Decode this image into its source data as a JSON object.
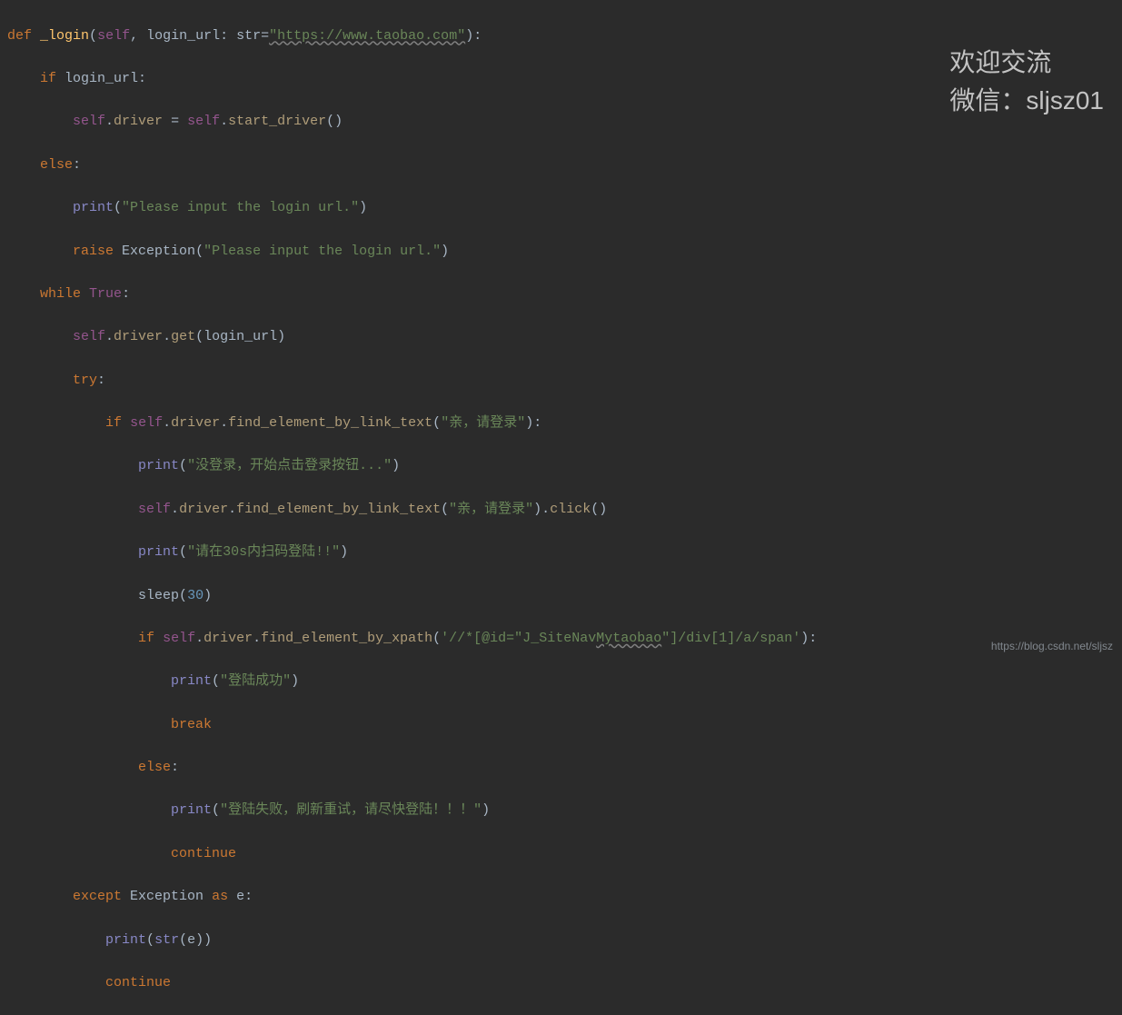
{
  "code": {
    "l1_def": "def",
    "l1_fn": "_login",
    "l1_open": "(",
    "l1_self": "self",
    "l1_comma": ",",
    "l1_param": " login_url",
    "l1_colon": ": ",
    "l1_type": "str",
    "l1_eq": "=",
    "l1_str": "\"https://www.taobao.com\"",
    "l1_close": "):",
    "l2_if": "if",
    "l2_cond": " login_url",
    "l2_colon": ":",
    "l3_self": "self",
    "l3_dot1": ".",
    "l3_driver_attr": "driver",
    "l3_eq": " = ",
    "l3_self2": "self",
    "l3_dot2": ".",
    "l3_start": "start_driver",
    "l3_call": "()",
    "l4_else": "else",
    "l4_colon": ":",
    "l5_print": "print",
    "l5_open": "(",
    "l5_str": "\"Please input the login url.\"",
    "l5_close": ")",
    "l6_raise": "raise",
    "l6_sp": " ",
    "l6_exc": "Exception",
    "l6_open": "(",
    "l6_str": "\"Please input the login url.\"",
    "l6_close": ")",
    "l7_while": "while",
    "l7_sp": " ",
    "l7_true": "True",
    "l7_colon": ":",
    "l8_self": "self",
    "l8_dot": ".",
    "l8_driver": "driver",
    "l8_dot2": ".",
    "l8_get": "get",
    "l8_open": "(",
    "l8_arg": "login_url",
    "l8_close": ")",
    "l9_try": "try",
    "l9_colon": ":",
    "l10_if": "if",
    "l10_sp": " ",
    "l10_self": "self",
    "l10_dot": ".",
    "l10_driver": "driver",
    "l10_dot2": ".",
    "l10_find": "find_element_by_link_text",
    "l10_open": "(",
    "l10_str": "\"亲，请登录\"",
    "l10_close": "):",
    "l11_print": "print",
    "l11_open": "(",
    "l11_str": "\"没登录，开始点击登录按钮...\"",
    "l11_close": ")",
    "l12_self": "self",
    "l12_dot": ".",
    "l12_driver": "driver",
    "l12_dot2": ".",
    "l12_find": "find_element_by_link_text",
    "l12_open": "(",
    "l12_str": "\"亲，请登录\"",
    "l12_close": ").",
    "l12_click": "click",
    "l12_call": "()",
    "l13_print": "print",
    "l13_open": "(",
    "l13_str": "\"请在30s内扫码登陆!!\"",
    "l13_close": ")",
    "l14_sleep": "sleep",
    "l14_open": "(",
    "l14_num": "30",
    "l14_close": ")",
    "l15_if": "if",
    "l15_sp": " ",
    "l15_self": "self",
    "l15_dot": ".",
    "l15_driver": "driver",
    "l15_dot2": ".",
    "l15_find": "find_element_by_xpath",
    "l15_open": "(",
    "l15_str_a": "'//*[@id=\"J_SiteNav",
    "l15_str_b": "Mytaobao",
    "l15_str_c": "\"]/div[1]/a/span'",
    "l15_close": "):",
    "l16_print": "print",
    "l16_open": "(",
    "l16_str": "\"登陆成功\"",
    "l16_close": ")",
    "l17_break": "break",
    "l18_else": "else",
    "l18_colon": ":",
    "l19_print": "print",
    "l19_open": "(",
    "l19_str": "\"登陆失败，刷新重试，请尽快登陆！！！\"",
    "l19_close": ")",
    "l20_continue": "continue",
    "l21_except": "except",
    "l21_sp": " ",
    "l21_exc": "Exception",
    "l21_sp2": " ",
    "l21_as": "as",
    "l21_sp3": " ",
    "l21_e": "e",
    "l21_colon": ":",
    "l22_print": "print",
    "l22_open": "(",
    "l22_str": "str",
    "l22_open2": "(",
    "l22_e": "e",
    "l22_close": "))",
    "l23_continue": "continue"
  },
  "overlay": {
    "line1": "欢迎交流",
    "line2": "微信：sljsz01"
  },
  "watermark": "https://blog.csdn.net/sljsz"
}
